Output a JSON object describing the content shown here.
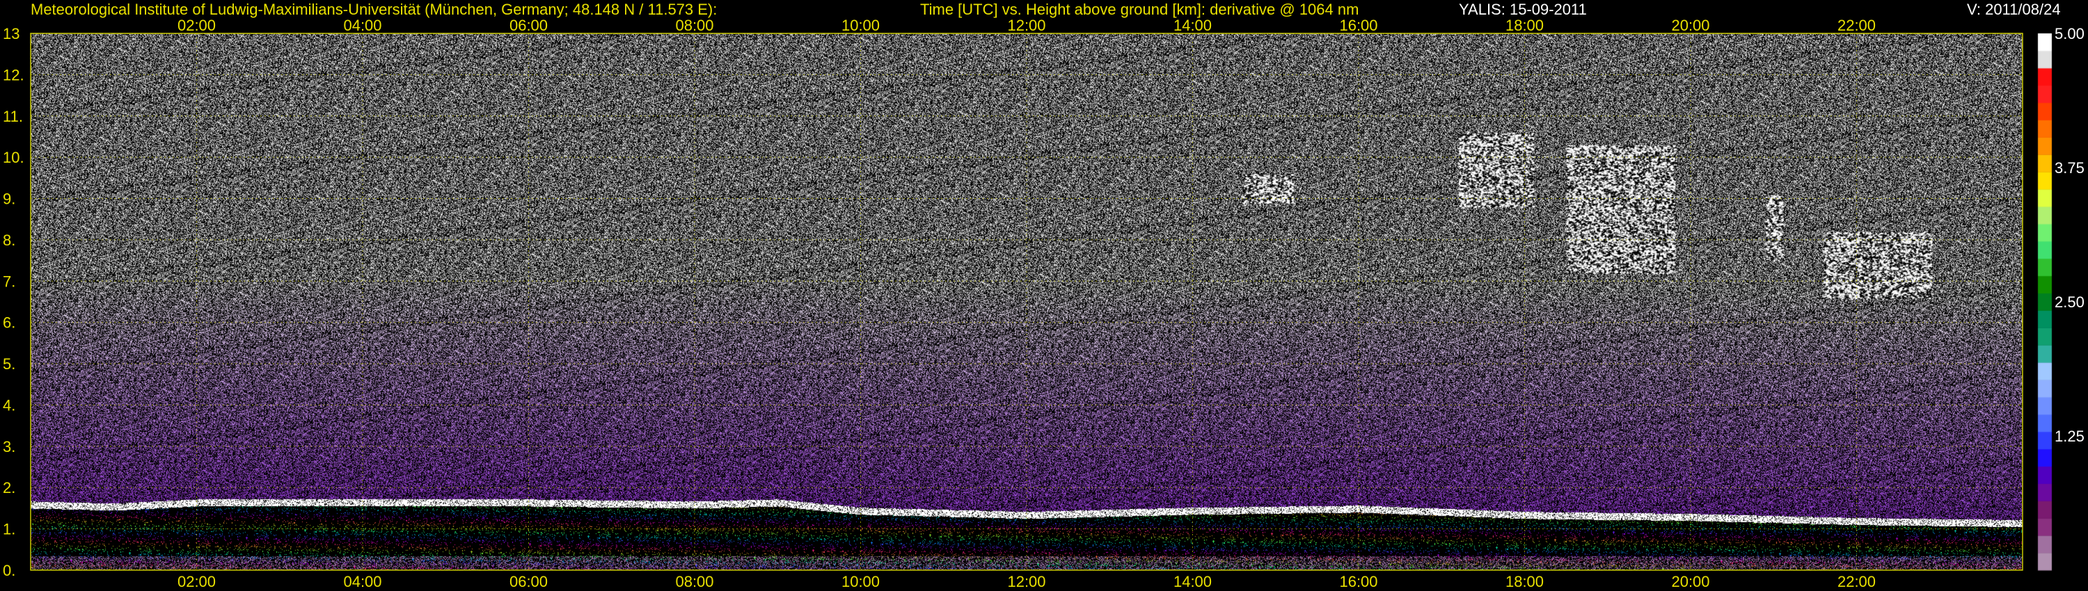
{
  "header": {
    "institute": "Meteorological Institute of Ludwig-Maximilians-Universität (München, Germany; 48.148 N / 11.573 E):",
    "plot_description": "Time [UTC] vs. Height above ground [km]: derivative @ 1064 nm",
    "instrument_date": "YALIS: 15-09-2011",
    "version": "V: 2011/08/24"
  },
  "colors": {
    "header_text": "#e8e000",
    "grid": "#c8c800",
    "axis_text": "#e8e000",
    "background": "#000000"
  },
  "chart_data": {
    "type": "heatmap",
    "x": {
      "unit": "UTC",
      "range": [
        "00:00",
        "24:00"
      ],
      "ticks": [
        "02:00",
        "04:00",
        "06:00",
        "08:00",
        "10:00",
        "12:00",
        "14:00",
        "16:00",
        "18:00",
        "20:00",
        "22:00"
      ]
    },
    "y": {
      "unit": "km",
      "range": [
        0,
        13
      ],
      "ticks": [
        "0.",
        "1.",
        "2.",
        "3.",
        "4.",
        "5.",
        "6.",
        "7.",
        "8.",
        "9.",
        "10.",
        "11.",
        "12.",
        "13"
      ]
    },
    "colorbar": {
      "range": [
        0,
        5
      ],
      "ticks": [
        "1.25",
        "2.50",
        "3.75",
        "5.00"
      ],
      "colors": [
        "#b090b0",
        "#a070a0",
        "#8a3080",
        "#7a1a70",
        "#6a0aa0",
        "#5000c0",
        "#2010ff",
        "#3040ff",
        "#5070ff",
        "#7090ff",
        "#90b0ff",
        "#a0c8ff",
        "#30b0a0",
        "#10a070",
        "#009060",
        "#008020",
        "#109000",
        "#30c030",
        "#40e070",
        "#70f070",
        "#b0f070",
        "#e0ff40",
        "#ffe000",
        "#ffc000",
        "#ff9000",
        "#ff7000",
        "#ff4000",
        "#ff2020",
        "#ff1010",
        "#e0e0e0",
        "#ffffff"
      ]
    },
    "grid": true,
    "boundary_layer_km": [
      {
        "t": 0.0,
        "h": 1.55
      },
      {
        "t": 1.0,
        "h": 1.5
      },
      {
        "t": 2.0,
        "h": 1.6
      },
      {
        "t": 4.0,
        "h": 1.6
      },
      {
        "t": 6.0,
        "h": 1.6
      },
      {
        "t": 8.0,
        "h": 1.55
      },
      {
        "t": 9.0,
        "h": 1.6
      },
      {
        "t": 10.0,
        "h": 1.4
      },
      {
        "t": 11.0,
        "h": 1.35
      },
      {
        "t": 12.0,
        "h": 1.3
      },
      {
        "t": 14.0,
        "h": 1.4
      },
      {
        "t": 16.0,
        "h": 1.45
      },
      {
        "t": 18.0,
        "h": 1.3
      },
      {
        "t": 20.0,
        "h": 1.25
      },
      {
        "t": 22.0,
        "h": 1.15
      },
      {
        "t": 24.0,
        "h": 1.1
      }
    ],
    "cloud_features": [
      {
        "t_start": 14.6,
        "t_end": 15.2,
        "h_low": 8.9,
        "h_high": 9.6
      },
      {
        "t_start": 17.2,
        "t_end": 18.1,
        "h_low": 8.8,
        "h_high": 10.6
      },
      {
        "t_start": 18.5,
        "t_end": 19.8,
        "h_low": 7.2,
        "h_high": 10.3
      },
      {
        "t_start": 20.9,
        "t_end": 21.1,
        "h_low": 7.5,
        "h_high": 9.1
      },
      {
        "t_start": 21.6,
        "t_end": 22.9,
        "h_low": 6.6,
        "h_high": 8.2
      }
    ]
  }
}
